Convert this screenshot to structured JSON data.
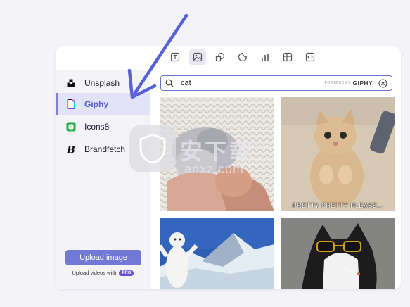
{
  "toolbar": {
    "tools": [
      {
        "icon": "text-icon"
      },
      {
        "icon": "image-icon",
        "active": true
      },
      {
        "icon": "shapes-icon"
      },
      {
        "icon": "sticker-icon"
      },
      {
        "icon": "chart-icon"
      },
      {
        "icon": "table-icon"
      },
      {
        "icon": "embed-icon"
      }
    ]
  },
  "sidebar": {
    "items": [
      {
        "label": "Unsplash",
        "icon": "unsplash-icon"
      },
      {
        "label": "Giphy",
        "icon": "giphy-icon",
        "active": true
      },
      {
        "label": "Icons8",
        "icon": "icons8-icon"
      },
      {
        "label": "Brandfetch",
        "icon": "brandfetch-icon"
      }
    ],
    "upload_label": "Upload image",
    "upload_note": "Upload videos with",
    "pro_badge": "PRO"
  },
  "search": {
    "value": "cat",
    "powered_by": "POWERED BY",
    "provider": "GIPHY"
  },
  "results": [
    {
      "alt": "cat gif 1",
      "caption": ""
    },
    {
      "alt": "cat gif 2",
      "caption": "PRETTY PRETTY PLEASE..."
    },
    {
      "alt": "cat gif 3",
      "caption": ""
    },
    {
      "alt": "cat gif 4",
      "caption": ""
    }
  ],
  "watermark": {
    "text": "安下载",
    "sub": "anxz.com"
  },
  "colors": {
    "accent": "#6d72cf",
    "arrow": "#5a62d8",
    "pro": "#6a4fd6"
  }
}
